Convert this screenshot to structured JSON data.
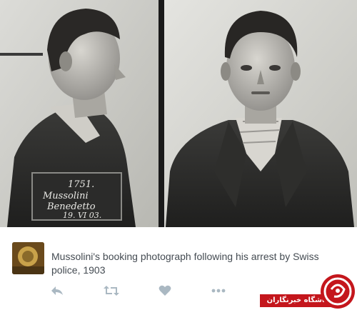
{
  "photo": {
    "placard_number": "1751.",
    "placard_name_1": "Mussolini",
    "placard_name_2": "Benedetto",
    "placard_date": "19. VI 03."
  },
  "tweet": {
    "text": "Mussolini's booking photograph following his arrest by Swiss police, 1903"
  },
  "actions": [
    {
      "icon": "reply-icon"
    },
    {
      "icon": "retweet-icon"
    },
    {
      "icon": "like-icon"
    },
    {
      "icon": "more-icon"
    }
  ],
  "badge": {
    "label": "باشگاه خبرنگاران"
  },
  "colors": {
    "action_icon": "#aab8c2",
    "badge_red": "#c4161c",
    "tweet_text": "#444b52"
  }
}
